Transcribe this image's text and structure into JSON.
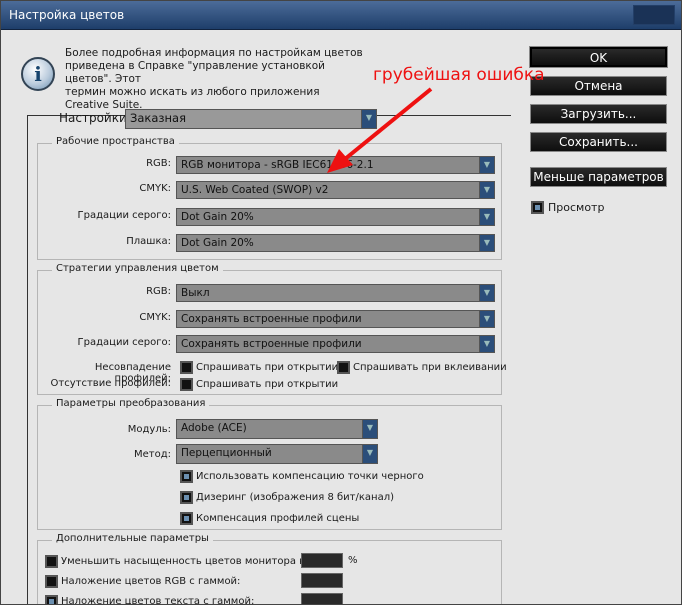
{
  "window": {
    "title": "Настройка цветов"
  },
  "info": {
    "text_line1": "Более подробная информация по настройкам цветов",
    "text_line2": "приведена в Справке \"управление установкой цветов\". Этот",
    "text_line3": "термин можно искать из любого приложения Creative Suite."
  },
  "annotation": {
    "text": "грубейшая ошибка",
    "color": "#ee1111"
  },
  "buttons": {
    "ok": "OK",
    "cancel": "Отмена",
    "load": "Загрузить...",
    "save": "Сохранить...",
    "fewer": "Меньше параметров"
  },
  "preview": {
    "label": "Просмотр",
    "checked": true
  },
  "settings": {
    "label": "Настройки:",
    "value": "Заказная"
  },
  "working_spaces": {
    "title": "Рабочие пространства",
    "rgb_label": "RGB:",
    "rgb_value": "RGB монитора - sRGB IEC61966-2.1",
    "cmyk_label": "CMYK:",
    "cmyk_value": "U.S. Web Coated (SWOP) v2",
    "gray_label": "Градации серого:",
    "gray_value": "Dot Gain 20%",
    "spot_label": "Плашка:",
    "spot_value": "Dot Gain 20%"
  },
  "policies": {
    "title": "Стратегии управления цветом",
    "rgb_label": "RGB:",
    "rgb_value": "Выкл",
    "cmyk_label": "CMYK:",
    "cmyk_value": "Сохранять встроенные профили",
    "gray_label": "Градации серого:",
    "gray_value": "Сохранять встроенные профили",
    "mismatch_label": "Несовпадение профилей:",
    "ask_open": "Спрашивать при открытии",
    "ask_paste": "Спрашивать при вклеивании",
    "missing_label": "Отсутствие профилей:",
    "ask_open2": "Спрашивать при открытии"
  },
  "conversion": {
    "title": "Параметры преобразования",
    "engine_label": "Модуль:",
    "engine_value": "Adobe (ACE)",
    "intent_label": "Метод:",
    "intent_value": "Перцепционный",
    "bpc": "Использовать компенсацию точки черного",
    "dither": "Дизеринг (изображения 8 бит/канал)",
    "scene": "Компенсация профилей сцены"
  },
  "advanced": {
    "title": "Дополнительные параметры",
    "desaturate": "Уменьшить насыщенность цветов монитора на:",
    "percent": "%",
    "blend_rgb": "Наложение цветов RGB с гаммой:",
    "blend_text": "Наложение цветов текста с гаммой:"
  }
}
